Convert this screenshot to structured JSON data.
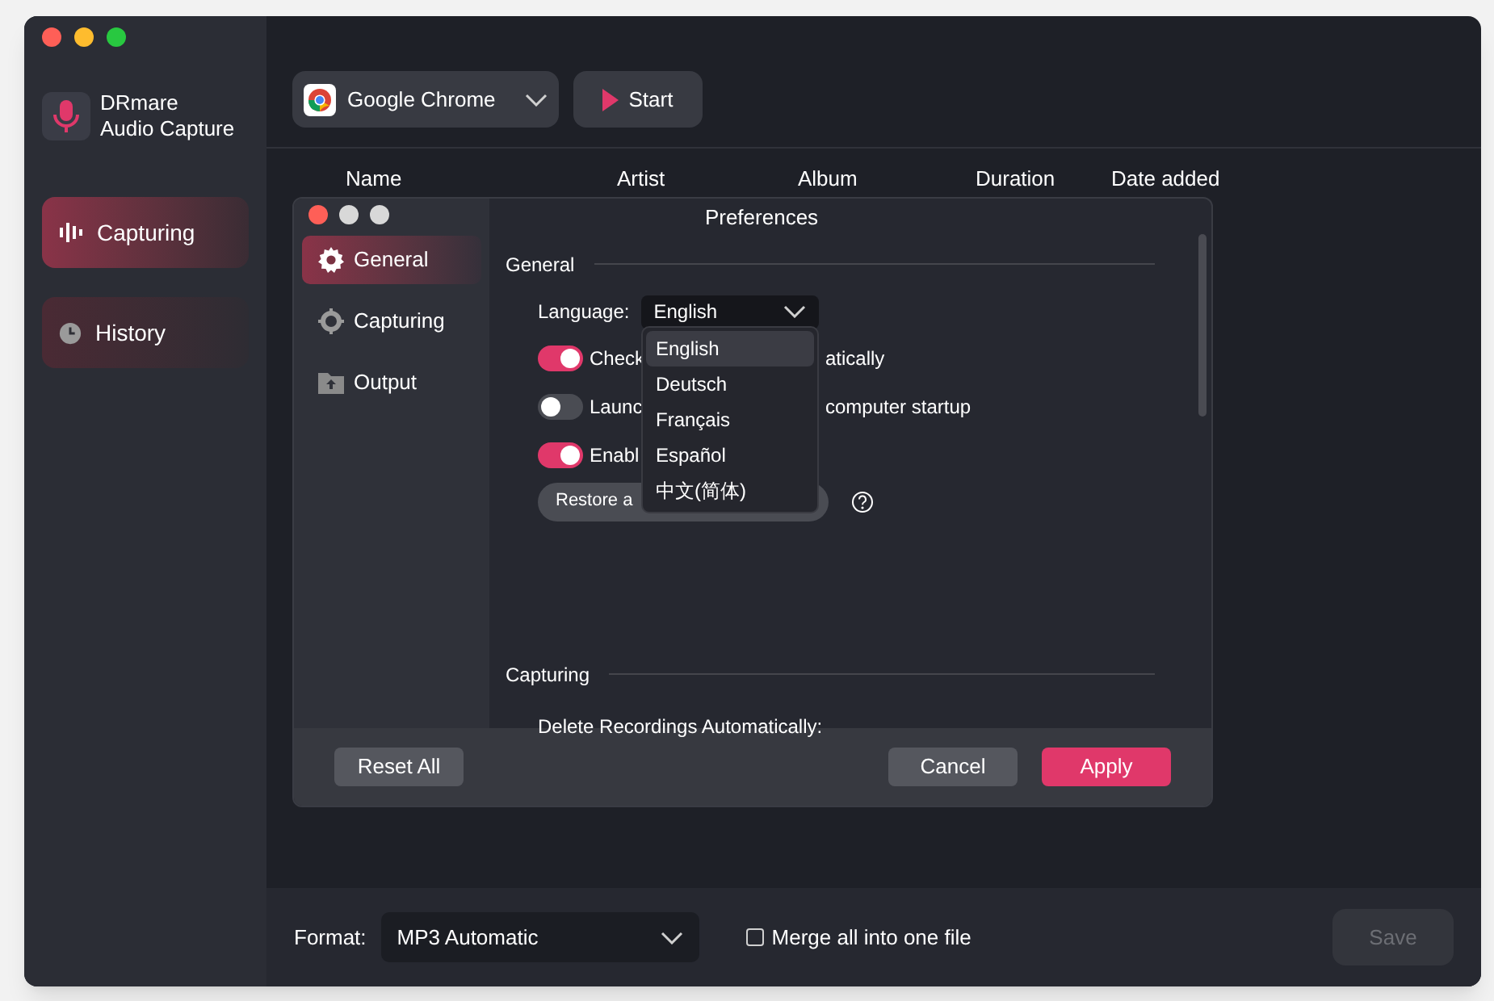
{
  "app": {
    "name": "DRmare",
    "subtitle": "Audio Capture"
  },
  "sidebar": {
    "items": [
      {
        "label": "Capturing",
        "kind": "wave",
        "selected": true
      },
      {
        "label": "History",
        "kind": "clock",
        "selected": false
      }
    ]
  },
  "toolbar": {
    "source": "Google Chrome",
    "start": "Start"
  },
  "table": {
    "columns": [
      "Name",
      "Artist",
      "Album",
      "Duration",
      "Date added"
    ]
  },
  "preferences": {
    "title": "Preferences",
    "nav": [
      {
        "label": "General",
        "kind": "gear",
        "selected": true
      },
      {
        "label": "Capturing",
        "kind": "target",
        "selected": false
      },
      {
        "label": "Output",
        "kind": "folder",
        "selected": false
      }
    ],
    "general_heading": "General",
    "language_label": "Language:",
    "language_value": "English",
    "toggles": [
      {
        "label_start": "Check",
        "label_end": "atically",
        "on": true
      },
      {
        "label_start": "Launc",
        "label_end": "computer startup",
        "on": false
      },
      {
        "label_start": "Enabl",
        "on": true
      }
    ],
    "restore": "Restore a",
    "capturing_heading": "Capturing",
    "delete_label": "Delete Recordings Automatically:",
    "reset": "Reset All",
    "cancel": "Cancel",
    "apply": "Apply",
    "language_options": [
      {
        "label": "English",
        "selected": true
      },
      {
        "label": "Deutsch",
        "selected": false
      },
      {
        "label": "Français",
        "selected": false
      },
      {
        "label": "Español",
        "selected": false
      },
      {
        "label": "中文(简体)",
        "selected": false
      }
    ]
  },
  "bottom": {
    "format_label": "Format:",
    "format_value": "MP3 Automatic",
    "merge_label": "Merge all into one file",
    "merge_checked": false,
    "save": "Save",
    "save_disabled": true
  }
}
